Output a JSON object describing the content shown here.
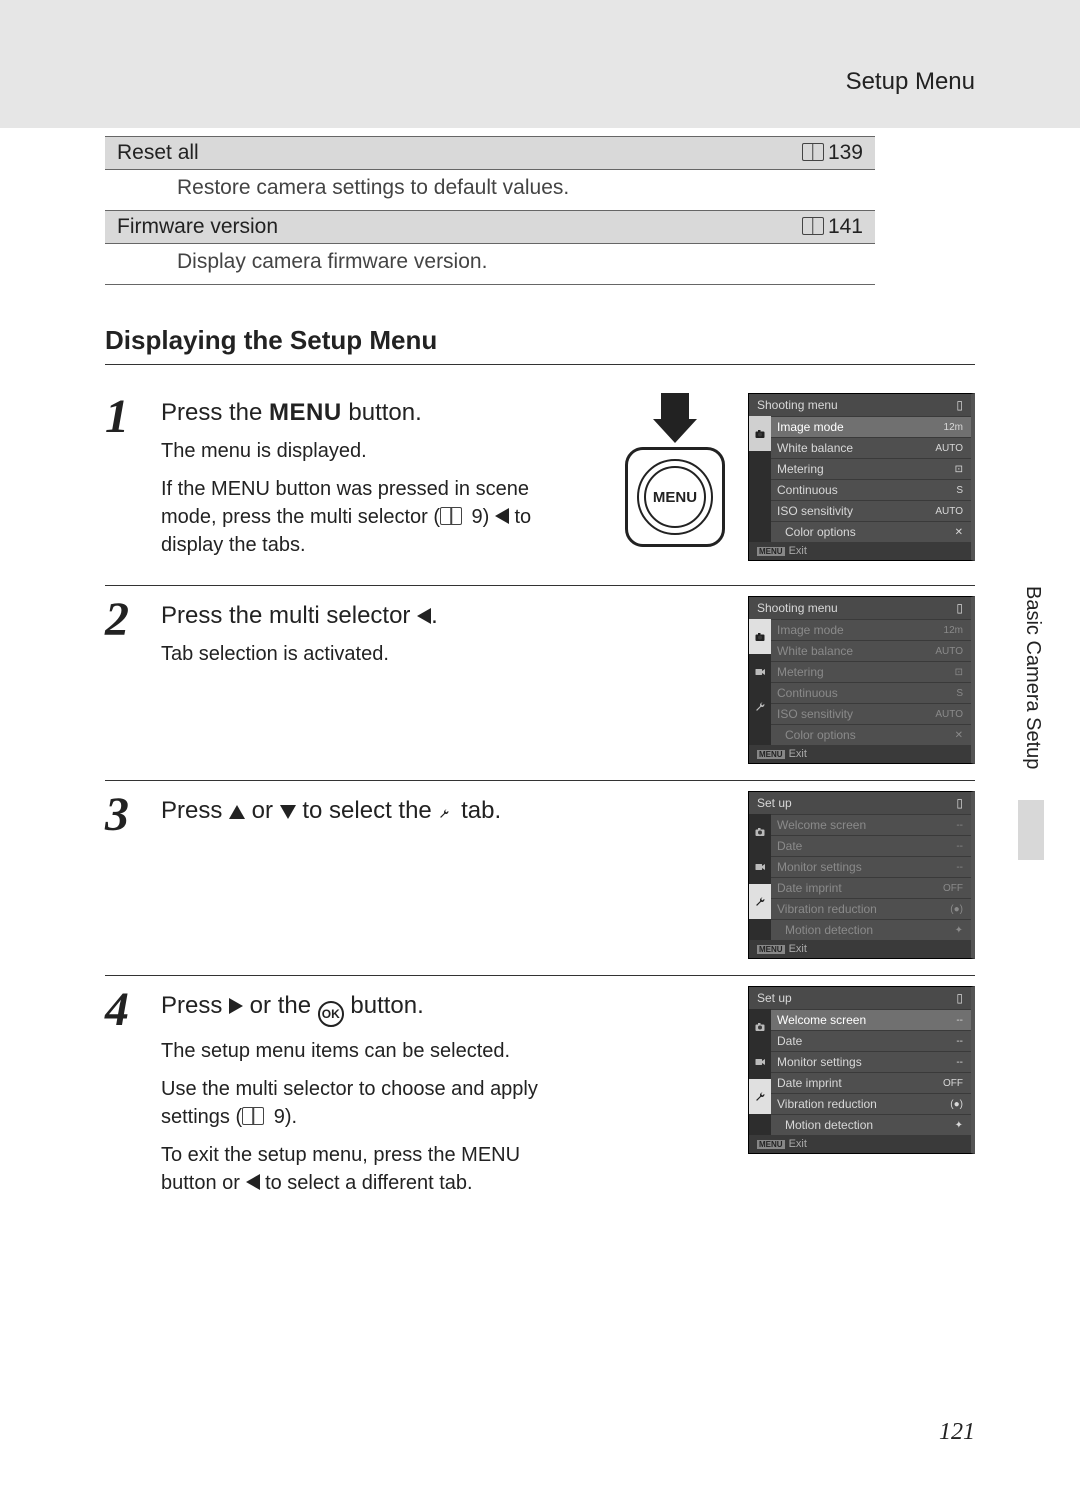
{
  "header": {
    "title": "Setup Menu"
  },
  "menu_table": [
    {
      "name": "Reset all",
      "page": "139",
      "desc": "Restore camera settings to default values."
    },
    {
      "name": "Firmware version",
      "page": "141",
      "desc": "Display camera firmware version."
    }
  ],
  "section_heading": "Displaying the Setup Menu",
  "steps": [
    {
      "num": "1",
      "head_pre": "Press the ",
      "head_menu": "MENU",
      "head_post": " button.",
      "p1": "The menu is displayed.",
      "p2_pre": "If the ",
      "p2_menu": "MENU",
      "p2_mid": " button was pressed in scene mode, press the multi selector (",
      "p2_ref": "9",
      "p2_mid2": ") ",
      "p2_post": " to display the tabs.",
      "lcd": {
        "title": "Shooting menu",
        "dimmed": false,
        "tabs": [
          {
            "t": "camera",
            "active": true
          },
          {
            "t": "movie"
          },
          {
            "t": "wrench"
          }
        ],
        "tabs_show": [
          "camera"
        ],
        "rows": [
          {
            "label": "Image mode",
            "val": "12m",
            "hl": true
          },
          {
            "label": "White balance",
            "val": "AUTO"
          },
          {
            "label": "Metering",
            "val": "⊡"
          },
          {
            "label": "Continuous",
            "val": "S"
          },
          {
            "label": "ISO sensitivity",
            "val": "AUTO"
          },
          {
            "label": "Color options",
            "val": "✕",
            "indent": true
          }
        ],
        "exit": "Exit"
      }
    },
    {
      "num": "2",
      "head_pre": "Press the multi selector ",
      "head_tri": "left",
      "head_post": ".",
      "p1": "Tab selection is activated.",
      "lcd": {
        "title": "Shooting menu",
        "dimmed": true,
        "tabs_show": [
          "camera",
          "movie",
          "wrench"
        ],
        "active_tab": 0,
        "rows": [
          {
            "label": "Image mode",
            "val": "12m"
          },
          {
            "label": "White balance",
            "val": "AUTO"
          },
          {
            "label": "Metering",
            "val": "⊡"
          },
          {
            "label": "Continuous",
            "val": "S"
          },
          {
            "label": "ISO sensitivity",
            "val": "AUTO"
          },
          {
            "label": "Color options",
            "val": "✕",
            "indent": true
          }
        ],
        "exit": "Exit"
      }
    },
    {
      "num": "3",
      "head_pre": "Press ",
      "head_tri1": "up",
      "head_mid": " or ",
      "head_tri2": "down",
      "head_mid2": " to select the ",
      "head_icon": "wrench",
      "head_post": " tab.",
      "lcd": {
        "title": "Set up",
        "dimmed": true,
        "tabs_show": [
          "camera",
          "movie",
          "wrench"
        ],
        "active_tab": 2,
        "rows": [
          {
            "label": "Welcome screen",
            "val": "--"
          },
          {
            "label": "Date",
            "val": "--"
          },
          {
            "label": "Monitor settings",
            "val": "--"
          },
          {
            "label": "Date imprint",
            "val": "OFF"
          },
          {
            "label": "Vibration reduction",
            "val": "(●)"
          },
          {
            "label": "Motion detection",
            "val": "✦",
            "indent": true
          }
        ],
        "exit": "Exit"
      }
    },
    {
      "num": "4",
      "head_pre": "Press ",
      "head_tri": "right",
      "head_mid": " or the ",
      "head_ok": "OK",
      "head_post": " button.",
      "p1": "The setup menu items can be selected.",
      "p2_pre": "Use the multi selector to choose and apply settings (",
      "p2_ref": "9",
      "p2_post": ").",
      "p3_pre": "To exit the setup menu, press the ",
      "p3_menu": "MENU",
      "p3_mid": " button or ",
      "p3_tri": "left",
      "p3_post": " to select a different tab.",
      "lcd": {
        "title": "Set up",
        "dimmed": false,
        "tabs_show": [
          "camera",
          "movie",
          "wrench"
        ],
        "active_tab": 2,
        "rows": [
          {
            "label": "Welcome screen",
            "val": "--",
            "hl": true
          },
          {
            "label": "Date",
            "val": "--"
          },
          {
            "label": "Monitor settings",
            "val": "--"
          },
          {
            "label": "Date imprint",
            "val": "OFF"
          },
          {
            "label": "Vibration reduction",
            "val": "(●)"
          },
          {
            "label": "Motion detection",
            "val": "✦",
            "indent": true
          }
        ],
        "exit": "Exit"
      }
    }
  ],
  "side_tab": "Basic Camera Setup",
  "page_number": "121",
  "menu_btn_label": "MENU"
}
